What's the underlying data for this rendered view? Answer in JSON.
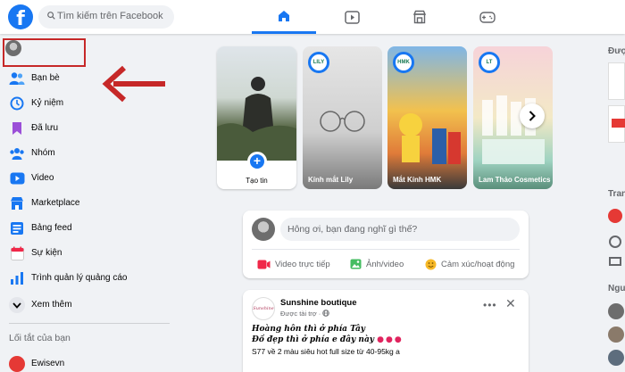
{
  "header": {
    "logo": "f",
    "search_placeholder": "Tìm kiếm trên Facebook",
    "nav_tabs": [
      "home-icon",
      "video-icon",
      "marketplace-icon",
      "gaming-icon"
    ]
  },
  "sidebar": {
    "items": [
      {
        "label": "Bạn bè"
      },
      {
        "label": "Kỷ niệm"
      },
      {
        "label": "Đã lưu"
      },
      {
        "label": "Nhóm"
      },
      {
        "label": "Video"
      },
      {
        "label": "Marketplace"
      },
      {
        "label": "Bảng feed"
      },
      {
        "label": "Sự kiện"
      },
      {
        "label": "Trình quản lý quảng cáo"
      },
      {
        "label": "Xem thêm"
      }
    ],
    "shortcuts_title": "Lối tắt của bạn",
    "shortcuts": [
      {
        "label": "Ewisevn"
      }
    ]
  },
  "stories": {
    "create_label": "Tạo tin",
    "items": [
      {
        "name": "Kính mắt Lily",
        "logo": "LILY"
      },
      {
        "name": "Mắt Kính HMK",
        "logo": "HMK"
      },
      {
        "name": "Lam Thảo Cosmetics",
        "logo": "LT"
      }
    ]
  },
  "composer": {
    "placeholder": "Hông ơi, bạn đang nghĩ gì thế?",
    "actions": [
      {
        "label": "Video trực tiếp",
        "color": "#f02849"
      },
      {
        "label": "Ảnh/video",
        "color": "#45bd62"
      },
      {
        "label": "Cảm xúc/hoạt động",
        "color": "#f7b928"
      }
    ]
  },
  "post": {
    "page_name": "Sunshine boutique",
    "sponsored": "Được tài trợ ·",
    "line1": "Hoàng hôn thì ở phía Tây",
    "line2": "Đồ đẹp thì ở phía e đây này",
    "line3": "S77 về 2 màu siêu hot full size từ 40-95kg a"
  },
  "right": {
    "t1": "Đượ",
    "t2": "Tran",
    "t3": "Ngu"
  },
  "colors": {
    "brand": "#1877f2",
    "annotation": "#c62828"
  }
}
